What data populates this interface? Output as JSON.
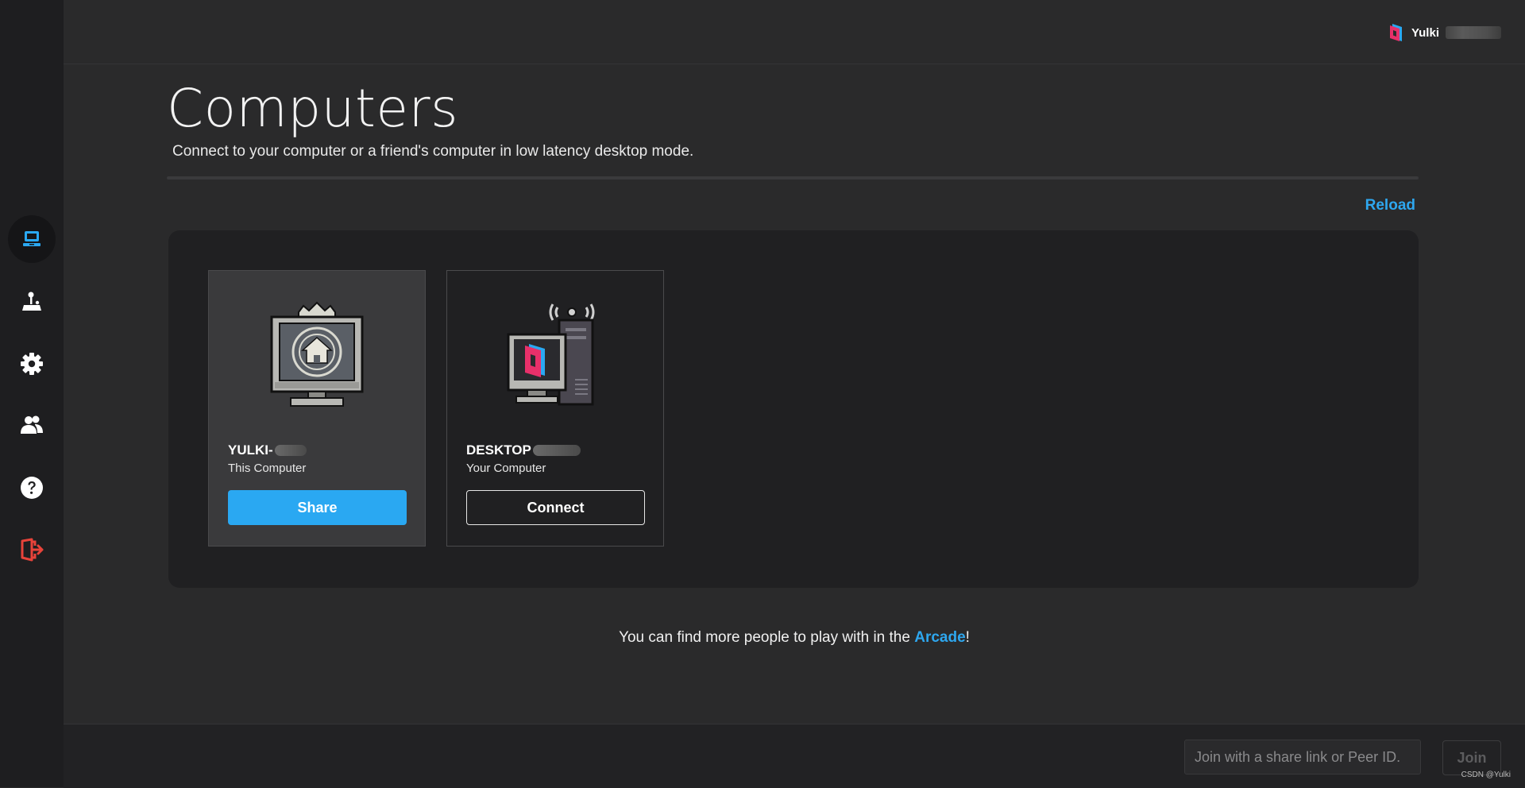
{
  "sidebar": {
    "items": [
      {
        "name": "computers",
        "icon": "computer-icon",
        "active": true
      },
      {
        "name": "arcade",
        "icon": "joystick-icon",
        "active": false
      },
      {
        "name": "settings",
        "icon": "gear-icon",
        "active": false
      },
      {
        "name": "friends",
        "icon": "users-icon",
        "active": false
      },
      {
        "name": "help",
        "icon": "help-icon",
        "active": false
      },
      {
        "name": "logout",
        "icon": "logout-icon",
        "active": false
      }
    ]
  },
  "header": {
    "user_name": "Yulki"
  },
  "page": {
    "title": "Computers",
    "subtitle": "Connect to your computer or a friend's computer in low latency desktop mode.",
    "reload_label": "Reload"
  },
  "computers": [
    {
      "name": "YULKI-",
      "subtitle": "This Computer",
      "action": "Share",
      "icon": "home-monitor-icon"
    },
    {
      "name": "DESKTOP",
      "subtitle": "Your Computer",
      "action": "Connect",
      "icon": "desktop-pc-icon"
    }
  ],
  "footer": {
    "note_prefix": "You can find more people to play with in the ",
    "note_link": "Arcade",
    "note_suffix": "!"
  },
  "join": {
    "placeholder": "Join with a share link or Peer ID.",
    "button_label": "Join"
  },
  "watermark": "CSDN @Yulki",
  "colors": {
    "accent": "#2aa8f2",
    "background": "#2a2a2b",
    "sidebar": "#1e1e20",
    "logout": "#e8433a"
  }
}
